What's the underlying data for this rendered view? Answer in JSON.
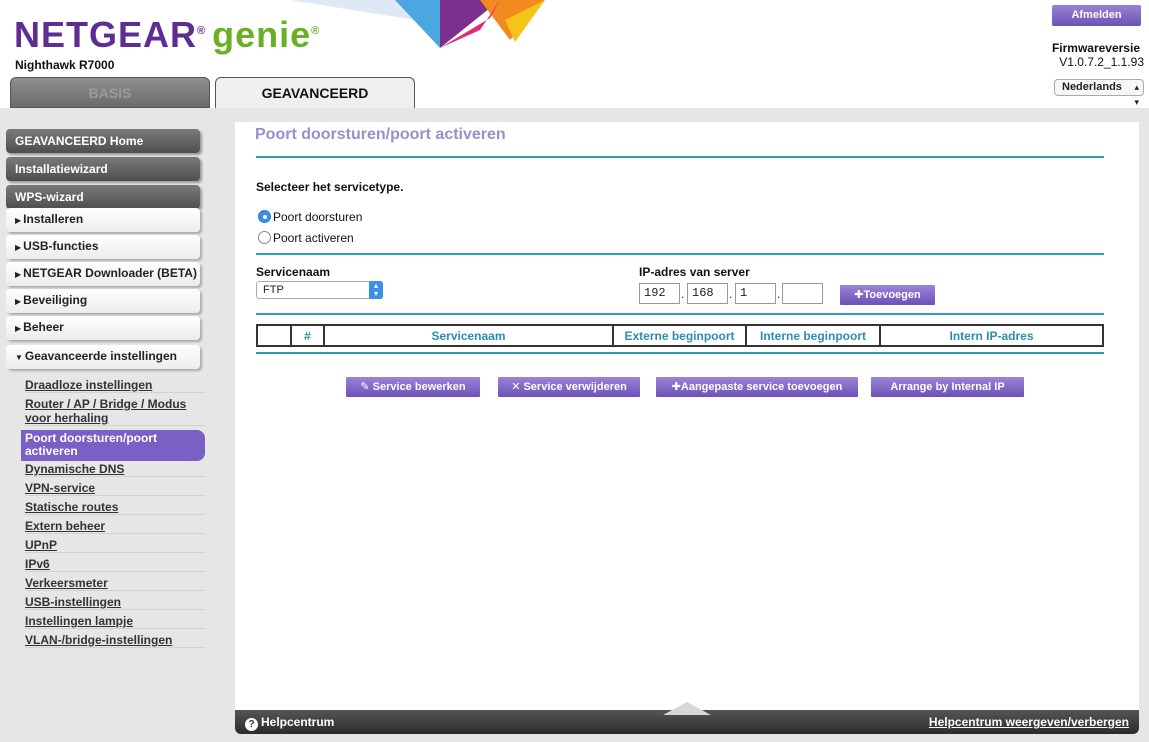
{
  "header": {
    "brand_main": "NETGEAR",
    "brand_reg": "®",
    "brand_genie": "genie",
    "brand_genie_reg": "®",
    "model": "Nighthawk R7000",
    "tabs": [
      {
        "label": "BASIS"
      },
      {
        "label": "GEAVANCEERD"
      }
    ],
    "logout_label": "Afmelden",
    "firmware_label": "Firmwareversie",
    "firmware_value": "V1.0.7.2_1.1.93",
    "language": "Nederlands"
  },
  "sidebar": {
    "main_items": [
      {
        "label": "GEAVANCEERD Home"
      },
      {
        "label": "Installatiewizard"
      },
      {
        "label": "WPS-wizard"
      }
    ],
    "sections": [
      {
        "label": "Installeren"
      },
      {
        "label": "USB-functies"
      },
      {
        "label": "NETGEAR Downloader (BETA)"
      },
      {
        "label": "Beveiliging"
      },
      {
        "label": "Beheer"
      },
      {
        "label": "Geavanceerde instellingen"
      }
    ],
    "sub_items": [
      {
        "label": "Draadloze instellingen"
      },
      {
        "label": "Router / AP / Bridge / Modus voor herhaling"
      },
      {
        "label": "Poort doorsturen/poort activeren"
      },
      {
        "label": "Dynamische DNS"
      },
      {
        "label": "VPN-service"
      },
      {
        "label": "Statische routes"
      },
      {
        "label": "Extern beheer"
      },
      {
        "label": "UPnP"
      },
      {
        "label": "IPv6"
      },
      {
        "label": "Verkeersmeter"
      },
      {
        "label": "USB-instellingen"
      },
      {
        "label": "Instellingen lampje"
      },
      {
        "label": "VLAN-/bridge-instellingen"
      }
    ],
    "active_sub_item": "Poort doorsturen/poort activeren"
  },
  "main": {
    "title": "Poort doorsturen/poort activeren",
    "service_type_label": "Selecteer het servicetype.",
    "radio_options": [
      {
        "label": "Poort doorsturen",
        "selected": true
      },
      {
        "label": "Poort activeren",
        "selected": false
      }
    ],
    "service_name_label": "Servicenaam",
    "service_name_value": "FTP",
    "server_ip_label": "IP-adres van server",
    "ip_octets": [
      "192",
      "168",
      "1",
      ""
    ],
    "add_button": "Toevoegen",
    "table_headers": [
      "",
      "#",
      "Servicenaam",
      "Externe beginpoort",
      "Interne beginpoort",
      "Intern IP-adres"
    ],
    "action_buttons": [
      {
        "label": "Service bewerken",
        "icon": "pencil-icon"
      },
      {
        "label": "Service verwijderen",
        "icon": "x-icon"
      },
      {
        "label": "Aangepaste service toevoegen",
        "icon": "plus-icon"
      },
      {
        "label": "Arrange by Internal IP",
        "icon": ""
      }
    ]
  },
  "footer": {
    "help_label": "Helpcentrum",
    "help_toggle": "Helpcentrum weergeven/verbergen"
  },
  "colors": {
    "accent_purple": "#6d52b5",
    "title_lavender": "#9b8ec9",
    "rule_teal": "#2e9bb7",
    "brand_purple": "#5e2d91",
    "brand_green": "#6ab023"
  }
}
